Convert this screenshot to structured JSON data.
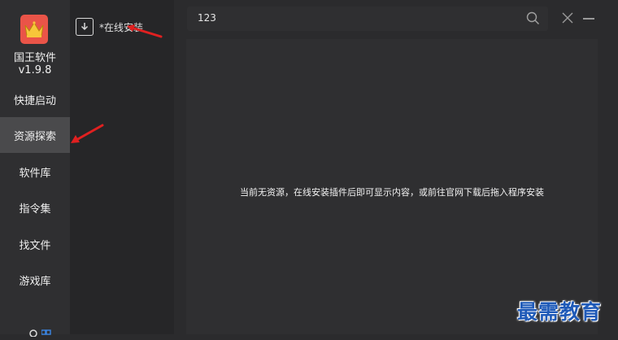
{
  "app": {
    "name": "国王软件",
    "version": "v1.9.8"
  },
  "nav": {
    "items": [
      {
        "label": "快捷启动",
        "active": false
      },
      {
        "label": "资源探索",
        "active": true
      },
      {
        "label": "软件库",
        "active": false
      },
      {
        "label": "指令集",
        "active": false
      },
      {
        "label": "找文件",
        "active": false
      },
      {
        "label": "游戏库",
        "active": false
      }
    ],
    "bottom_text": "⚙",
    "bottom_icon": "grid-icon"
  },
  "sidebar": {
    "install_label": "*在线安装"
  },
  "search": {
    "value": "123"
  },
  "main": {
    "empty_message": "当前无资源，在线安装插件后即可显示内容，或前往官网下载后拖入程序安装"
  },
  "watermark": "最需教育",
  "colors": {
    "accent": "#ea5448",
    "annotation": "#e02020",
    "watermark": "#1f5ab8"
  }
}
